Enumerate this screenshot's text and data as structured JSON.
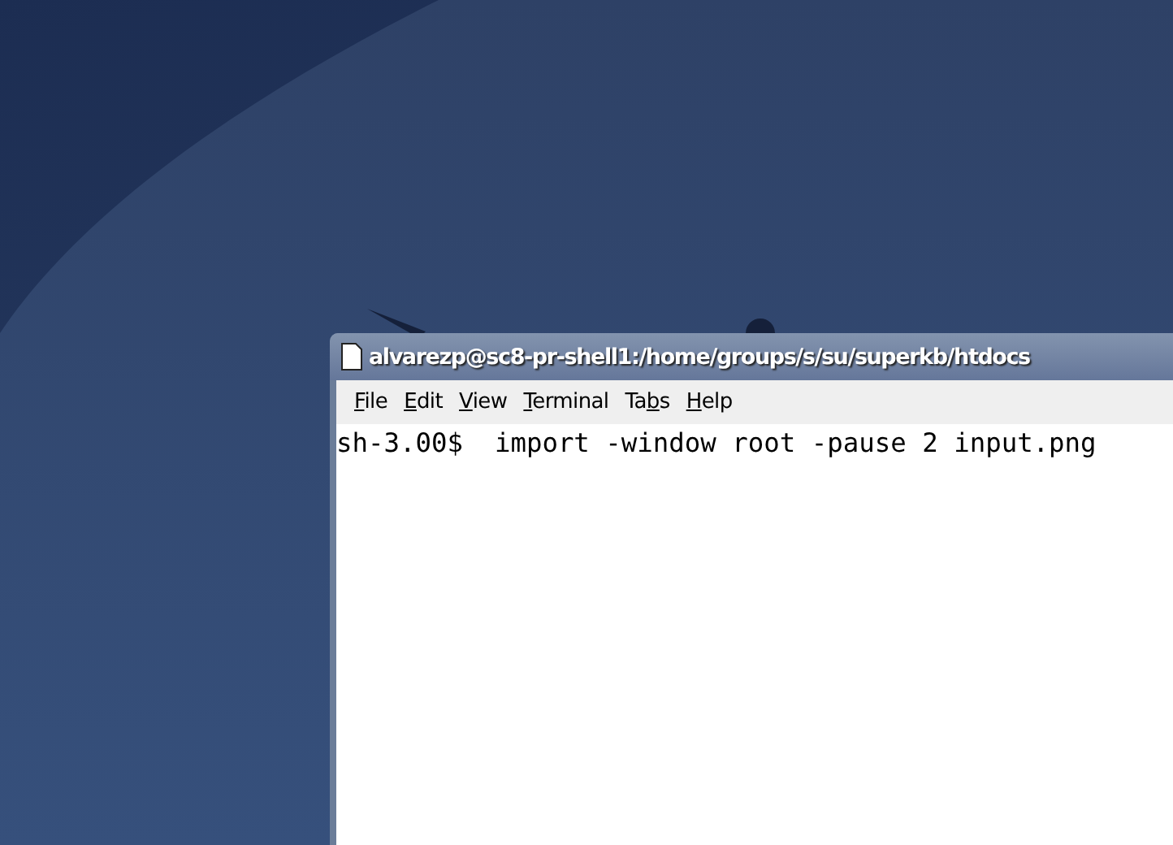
{
  "window": {
    "title": "alvarezp@sc8-pr-shell1:/home/groups/s/su/superkb/htdocs"
  },
  "menu": [
    {
      "parts": [
        {
          "text": "F",
          "underlined": true
        },
        {
          "text": "ile",
          "underlined": false
        }
      ]
    },
    {
      "parts": [
        {
          "text": "E",
          "underlined": true
        },
        {
          "text": "dit",
          "underlined": false
        }
      ]
    },
    {
      "parts": [
        {
          "text": "V",
          "underlined": true
        },
        {
          "text": "iew",
          "underlined": false
        }
      ]
    },
    {
      "parts": [
        {
          "text": "T",
          "underlined": true
        },
        {
          "text": "erminal",
          "underlined": false
        }
      ]
    },
    {
      "parts": [
        {
          "text": "Ta",
          "underlined": false
        },
        {
          "text": "b",
          "underlined": true
        },
        {
          "text": "s",
          "underlined": false
        }
      ]
    },
    {
      "parts": [
        {
          "text": "H",
          "underlined": true
        },
        {
          "text": "elp",
          "underlined": false
        }
      ]
    }
  ],
  "terminal": {
    "lines": [
      "sh-3.00$  import -window root -pause 2 input.png"
    ]
  }
}
